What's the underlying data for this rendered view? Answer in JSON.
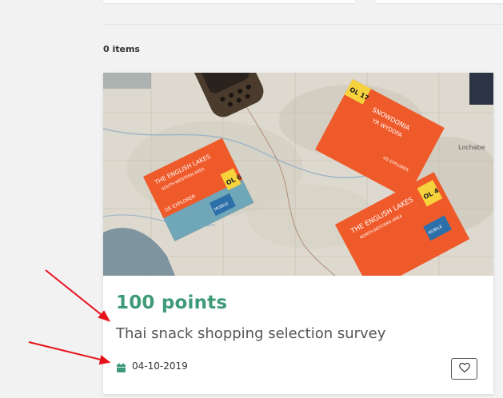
{
  "list": {
    "items_count": "0 items"
  },
  "card": {
    "image": {
      "subject": "Ordnance Survey explorer maps and a GPS unit on a map",
      "map_labels": {
        "box_top": "Lochabe",
        "box_left_title": "THE ENGLISH LAKES",
        "box_left_sub": "SOUTH-WESTERN AREA",
        "box_left_num": "OL 6",
        "box_left_brand": "OS EXPLORER",
        "box_right_title": "THE ENGLISH LAKES",
        "box_right_sub": "NORTH-WESTERN AREA",
        "box_right_num": "OL 4",
        "box_top_title": "SNOWDONIA",
        "box_top_sub": "YR WYDDFA",
        "box_top_num": "OL 17",
        "box_top_brand": "OS EXPLORER",
        "mobile": "MOBILE"
      }
    },
    "points": "100 points",
    "title": "Thai snack shopping selection survey",
    "date": "04-10-2019",
    "icons": {
      "calendar": "calendar-icon",
      "favorite": "heart-icon"
    }
  },
  "colors": {
    "accent": "#3f9a78",
    "map_orange": "#ef5a2a",
    "arrow": "#e8121c"
  }
}
